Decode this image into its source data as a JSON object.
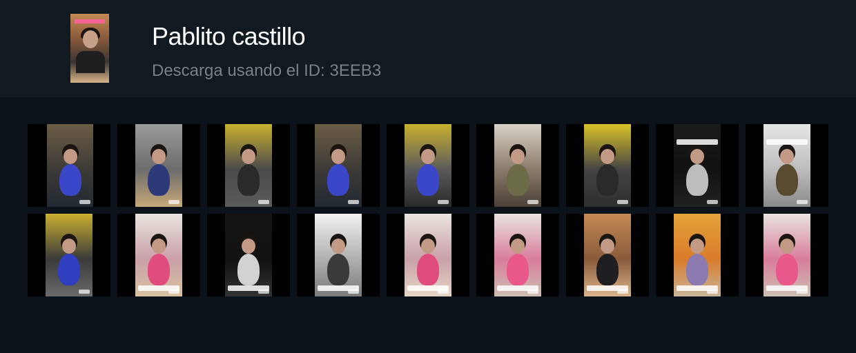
{
  "profile": {
    "name": "Pablito castillo",
    "download_text": "Descarga usando el ID: 3EEB3"
  },
  "colors": {
    "header_bg": "#111921",
    "page_bg": "#0c1219",
    "subtitle": "#7b8088"
  },
  "videos": [
    {
      "bg": [
        "#6b5d45",
        "#3d3a36",
        "#222a33"
      ],
      "fig": "#3a47c9",
      "caption": false
    },
    {
      "bg": [
        "#9a9a9a",
        "#6c6c6c",
        "#c7a878"
      ],
      "fig": "#2d3a7a",
      "caption": false
    },
    {
      "bg": [
        "#c9b030",
        "#4a4a4a",
        "#5b5b5b"
      ],
      "fig": "#2a2a2a",
      "caption": false
    },
    {
      "bg": [
        "#6b5d45",
        "#3d3a36",
        "#222a33"
      ],
      "fig": "#3a47c9",
      "caption": false
    },
    {
      "bg": [
        "#c9b030",
        "#5a5a5a",
        "#2a2a2a"
      ],
      "fig": "#3a47c9",
      "caption": false
    },
    {
      "bg": [
        "#d8d2c6",
        "#8a7a6a",
        "#4a4036"
      ],
      "fig": "#6b6b48",
      "caption": false
    },
    {
      "bg": [
        "#d8c227",
        "#444444",
        "#2e2e2e"
      ],
      "fig": "#2a2a2a",
      "caption": false
    },
    {
      "bg": [
        "#1a1a1a",
        "#111111",
        "#222222"
      ],
      "fig": "#bdbdbd",
      "caption": true
    },
    {
      "bg": [
        "#e6e6e6",
        "#bdbdbd",
        "#8a8a8a"
      ],
      "fig": "#5a4a30",
      "caption": true
    },
    {
      "bg": [
        "#c9b030",
        "#3a3a3a",
        "#6a6a6a"
      ],
      "fig": "#2f3fbf",
      "caption": false
    },
    {
      "bg": [
        "#e9e4de",
        "#c9a0a8",
        "#d9c2a0"
      ],
      "fig": "#e04c7e",
      "caption": true
    },
    {
      "bg": [
        "#151515",
        "#111111",
        "#333333"
      ],
      "fig": "#d2d2d2",
      "caption": true
    },
    {
      "bg": [
        "#f2f2f2",
        "#b0b0b0",
        "#7a7a7a"
      ],
      "fig": "#3a3a3a",
      "caption": true
    },
    {
      "bg": [
        "#e9e4de",
        "#c9a0a8",
        "#e6d6c6"
      ],
      "fig": "#e04c7e",
      "caption": true
    },
    {
      "bg": [
        "#e8e4e0",
        "#d97d9a",
        "#cdbfb2"
      ],
      "fig": "#e9588a",
      "caption": true
    },
    {
      "bg": [
        "#c48a55",
        "#8a5a3a",
        "#d9b48a"
      ],
      "fig": "#1f1f22",
      "caption": true
    },
    {
      "bg": [
        "#e5a33a",
        "#d97b2a",
        "#c9b49a"
      ],
      "fig": "#8b7bb0",
      "caption": true
    },
    {
      "bg": [
        "#e8e4e0",
        "#d97d9a",
        "#cdbfb2"
      ],
      "fig": "#e9588a",
      "caption": true
    }
  ]
}
